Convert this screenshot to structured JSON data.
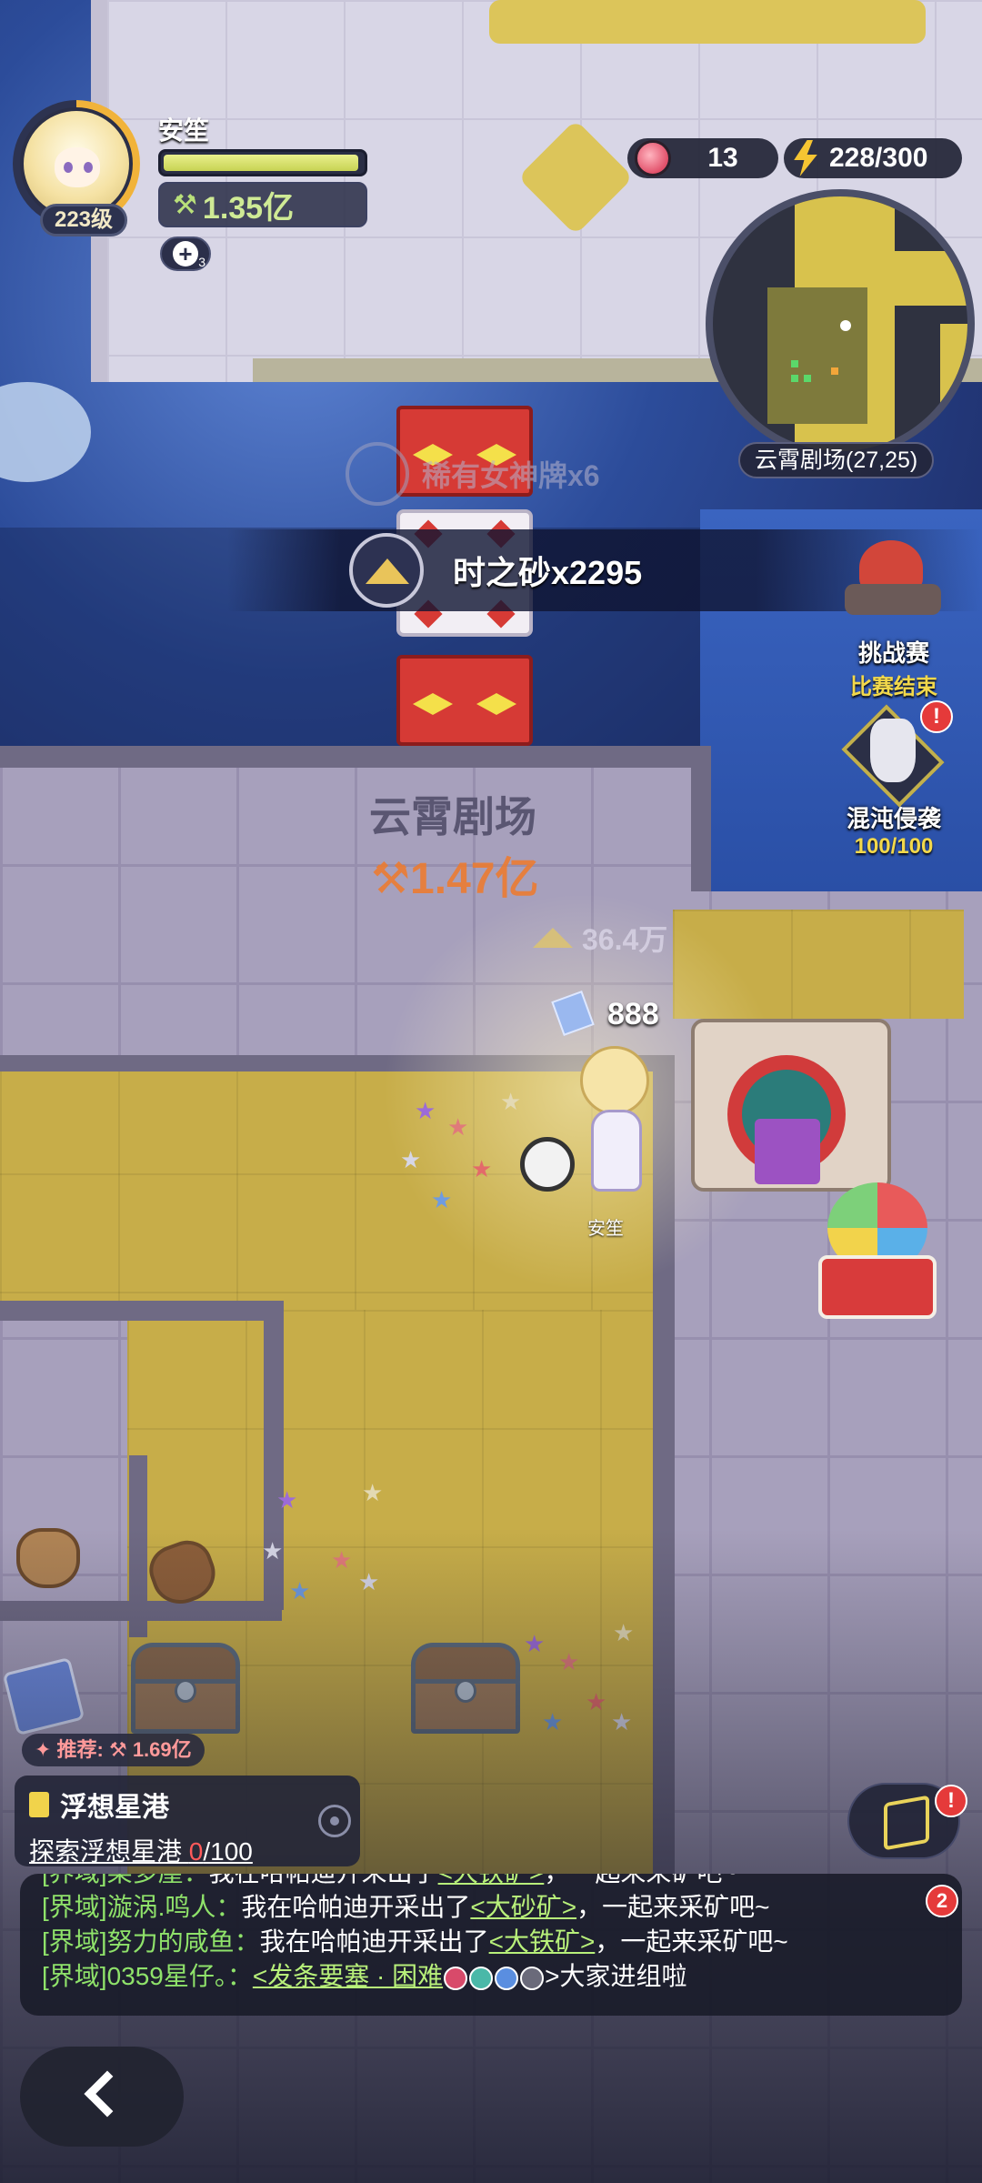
{
  "player": {
    "name": "安笙",
    "level": "223级",
    "power": "1.35亿",
    "buff_count": "3",
    "hp_fraction": 0.98
  },
  "resources": {
    "peach_count": "13",
    "energy": "228/300"
  },
  "minimap": {
    "location": "云霄剧场(27,25)"
  },
  "side_buttons": {
    "challenge": {
      "title": "挑战赛",
      "status": "比赛结束"
    },
    "chaos": {
      "title": "混沌侵袭",
      "status": "100/100",
      "alert": "!"
    }
  },
  "world": {
    "ghost_drop": "稀有女神牌x6",
    "drop_banner": "时之砂x2295",
    "zone_name": "云霄剧场",
    "zone_power": "1.47亿",
    "sand_amount": "36.4万",
    "damage": "888",
    "character_name": "安笙"
  },
  "quest": {
    "recommend": "✦ 推荐: ⚒ 1.69亿",
    "title": "浮想星港",
    "progress_label": "探索浮想星港",
    "progress_current": "0",
    "progress_total": "/100"
  },
  "box_button": {
    "alert": "!"
  },
  "chat": {
    "unread": "2",
    "lines": [
      {
        "channel": "[界域]",
        "sender": "梁多崖：",
        "text": "我在哈帕迪开采出了",
        "link": "<大铁矿>",
        "tail": "，一起来采矿吧~"
      },
      {
        "channel": "[界域]",
        "sender": "漩涡.鸣人：",
        "text": "我在哈帕迪开采出了",
        "link": "<大砂矿>",
        "tail": "，一起来采矿吧~"
      },
      {
        "channel": "[界域]",
        "sender": "努力的咸鱼：",
        "text": "我在哈帕迪开采出了",
        "link": "<大铁矿>",
        "tail": "，一起来采矿吧~"
      },
      {
        "channel": "[界域]",
        "sender": "0359星仔。：",
        "text": "",
        "link": "<发条要塞 · 困难",
        "tail": ">大家进组啦"
      }
    ]
  },
  "colors": {
    "power_green": "#cfea95",
    "zone_power_orange": "#f07a2a",
    "chat_channel_green": "#8fe26a",
    "alert_red": "#e53a3a",
    "status_yellow": "#f2d84b"
  },
  "icons": [
    "power-hammer-icon",
    "peach-icon",
    "lightning-icon",
    "sand-pile-icon",
    "quest-clipboard-icon",
    "target-icon",
    "cube-box-icon",
    "back-chevron-icon"
  ]
}
